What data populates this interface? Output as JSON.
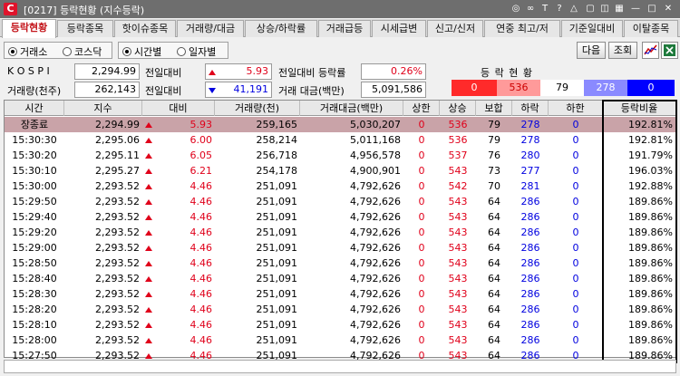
{
  "window": {
    "title": "[0217] 등락현황 (지수등락)",
    "app_letter": "C"
  },
  "tabs": [
    {
      "label": "등락현황",
      "active": true
    },
    {
      "label": "등락종목"
    },
    {
      "label": "핫이슈종목"
    },
    {
      "label": "거래량/대금"
    },
    {
      "label": "상승/하락률"
    },
    {
      "label": "거래급등"
    },
    {
      "label": "시세급변"
    },
    {
      "label": "신고/신저"
    },
    {
      "label": "연중 최고/저"
    },
    {
      "label": "기준일대비"
    },
    {
      "label": "이탈종목"
    }
  ],
  "market_radios": [
    {
      "label": "거래소",
      "checked": true
    },
    {
      "label": "코스닥",
      "checked": false
    }
  ],
  "view_radios": [
    {
      "label": "시간별",
      "checked": true
    },
    {
      "label": "일자별",
      "checked": false
    }
  ],
  "buttons": {
    "next": "다음",
    "query": "조회"
  },
  "summary": {
    "kospi_label": "K O S P I",
    "kospi_value": "2,294.99",
    "volume_label": "거래량(천주)",
    "volume_value": "262,143",
    "change_label_1": "전일대비",
    "change_value_1": "5.93",
    "change_label_2": "전일대비",
    "change_value_2": "41,191",
    "rate_label": "전일대비 등락률",
    "rate_value": "0.26%",
    "amount_label": "거래 대금(백만)",
    "amount_value": "5,091,586",
    "dist_title": "등 락 현 황",
    "dist": [
      {
        "value": "0",
        "color": "#ff2a2a",
        "text": "#ffffff"
      },
      {
        "value": "536",
        "color": "#ff9a9a",
        "text": "#cc0000"
      },
      {
        "value": "79",
        "color": "#ffffff",
        "text": "#000000"
      },
      {
        "value": "278",
        "color": "#8a8aff",
        "text": "#ffffff"
      },
      {
        "value": "0",
        "color": "#0000ff",
        "text": "#ffffff"
      }
    ]
  },
  "table": {
    "headers": [
      "시간",
      "지수",
      "대비",
      "거래량(천)",
      "거래대금(백만)",
      "상한",
      "상승",
      "보합",
      "하락",
      "하한",
      "등락비율"
    ],
    "rows": [
      {
        "time": "장종료",
        "index": "2,294.99",
        "change": "5.93",
        "volume": "259,165",
        "amount": "5,030,207",
        "upper": "0",
        "rise": "536",
        "flat": "79",
        "fall": "278",
        "lower": "0",
        "ratio": "192.81%",
        "highlight": true
      },
      {
        "time": "15:30:30",
        "index": "2,295.06",
        "change": "6.00",
        "volume": "258,214",
        "amount": "5,011,168",
        "upper": "0",
        "rise": "536",
        "flat": "79",
        "fall": "278",
        "lower": "0",
        "ratio": "192.81%"
      },
      {
        "time": "15:30:20",
        "index": "2,295.11",
        "change": "6.05",
        "volume": "256,718",
        "amount": "4,956,578",
        "upper": "0",
        "rise": "537",
        "flat": "76",
        "fall": "280",
        "lower": "0",
        "ratio": "191.79%"
      },
      {
        "time": "15:30:10",
        "index": "2,295.27",
        "change": "6.21",
        "volume": "254,178",
        "amount": "4,900,901",
        "upper": "0",
        "rise": "543",
        "flat": "73",
        "fall": "277",
        "lower": "0",
        "ratio": "196.03%"
      },
      {
        "time": "15:30:00",
        "index": "2,293.52",
        "change": "4.46",
        "volume": "251,091",
        "amount": "4,792,626",
        "upper": "0",
        "rise": "542",
        "flat": "70",
        "fall": "281",
        "lower": "0",
        "ratio": "192.88%"
      },
      {
        "time": "15:29:50",
        "index": "2,293.52",
        "change": "4.46",
        "volume": "251,091",
        "amount": "4,792,626",
        "upper": "0",
        "rise": "543",
        "flat": "64",
        "fall": "286",
        "lower": "0",
        "ratio": "189.86%"
      },
      {
        "time": "15:29:40",
        "index": "2,293.52",
        "change": "4.46",
        "volume": "251,091",
        "amount": "4,792,626",
        "upper": "0",
        "rise": "543",
        "flat": "64",
        "fall": "286",
        "lower": "0",
        "ratio": "189.86%"
      },
      {
        "time": "15:29:20",
        "index": "2,293.52",
        "change": "4.46",
        "volume": "251,091",
        "amount": "4,792,626",
        "upper": "0",
        "rise": "543",
        "flat": "64",
        "fall": "286",
        "lower": "0",
        "ratio": "189.86%"
      },
      {
        "time": "15:29:00",
        "index": "2,293.52",
        "change": "4.46",
        "volume": "251,091",
        "amount": "4,792,626",
        "upper": "0",
        "rise": "543",
        "flat": "64",
        "fall": "286",
        "lower": "0",
        "ratio": "189.86%"
      },
      {
        "time": "15:28:50",
        "index": "2,293.52",
        "change": "4.46",
        "volume": "251,091",
        "amount": "4,792,626",
        "upper": "0",
        "rise": "543",
        "flat": "64",
        "fall": "286",
        "lower": "0",
        "ratio": "189.86%"
      },
      {
        "time": "15:28:40",
        "index": "2,293.52",
        "change": "4.46",
        "volume": "251,091",
        "amount": "4,792,626",
        "upper": "0",
        "rise": "543",
        "flat": "64",
        "fall": "286",
        "lower": "0",
        "ratio": "189.86%"
      },
      {
        "time": "15:28:30",
        "index": "2,293.52",
        "change": "4.46",
        "volume": "251,091",
        "amount": "4,792,626",
        "upper": "0",
        "rise": "543",
        "flat": "64",
        "fall": "286",
        "lower": "0",
        "ratio": "189.86%"
      },
      {
        "time": "15:28:20",
        "index": "2,293.52",
        "change": "4.46",
        "volume": "251,091",
        "amount": "4,792,626",
        "upper": "0",
        "rise": "543",
        "flat": "64",
        "fall": "286",
        "lower": "0",
        "ratio": "189.86%"
      },
      {
        "time": "15:28:10",
        "index": "2,293.52",
        "change": "4.46",
        "volume": "251,091",
        "amount": "4,792,626",
        "upper": "0",
        "rise": "543",
        "flat": "64",
        "fall": "286",
        "lower": "0",
        "ratio": "189.86%"
      },
      {
        "time": "15:28:00",
        "index": "2,293.52",
        "change": "4.46",
        "volume": "251,091",
        "amount": "4,792,626",
        "upper": "0",
        "rise": "543",
        "flat": "64",
        "fall": "286",
        "lower": "0",
        "ratio": "189.86%"
      },
      {
        "time": "15:27:50",
        "index": "2,293.52",
        "change": "4.46",
        "volume": "251,091",
        "amount": "4,792,626",
        "upper": "0",
        "rise": "543",
        "flat": "64",
        "fall": "286",
        "lower": "0",
        "ratio": "189.86%"
      }
    ]
  },
  "colors": {
    "up": "#e0001a",
    "down": "#0000e0",
    "active_tab": "#c4161c",
    "highlight_row": "#c9a3a8"
  }
}
